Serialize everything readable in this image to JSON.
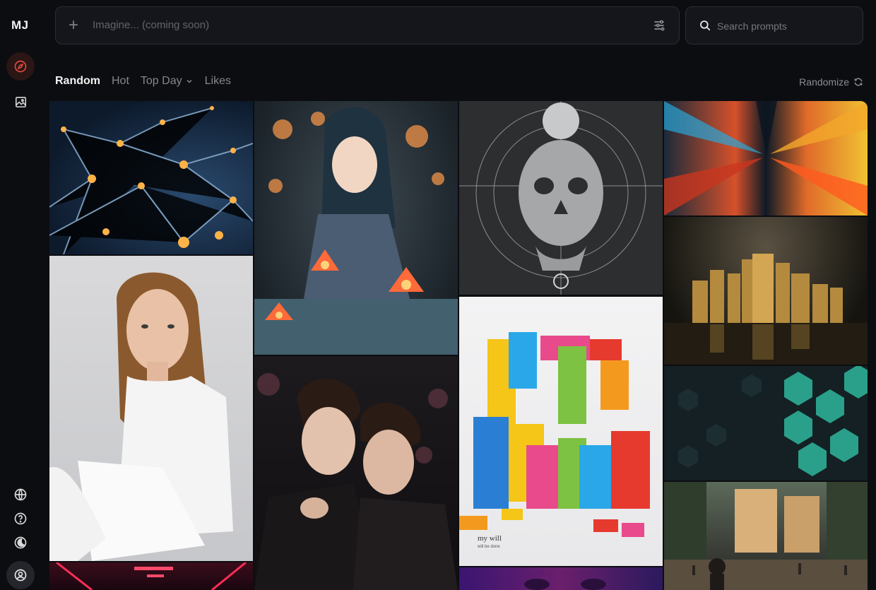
{
  "app": {
    "logo": "MJ"
  },
  "sidebar": {
    "items": [
      {
        "name": "explore",
        "icon": "compass-icon",
        "active": true
      },
      {
        "name": "create",
        "icon": "image-icon"
      }
    ],
    "bottom": [
      {
        "name": "language",
        "icon": "globe-icon"
      },
      {
        "name": "help",
        "icon": "help-icon"
      },
      {
        "name": "theme",
        "icon": "moon-icon"
      },
      {
        "name": "account",
        "icon": "user-icon"
      }
    ]
  },
  "prompt_bar": {
    "placeholder": "Imagine... (coming soon)"
  },
  "search": {
    "placeholder": "Search prompts"
  },
  "tabs": {
    "random": "Random",
    "hot": "Hot",
    "top_day": "Top Day",
    "likes": "Likes"
  },
  "randomize": "Randomize",
  "colors": {
    "accent": "#e4483d",
    "background": "#0c0d11",
    "field": "#15161b"
  }
}
